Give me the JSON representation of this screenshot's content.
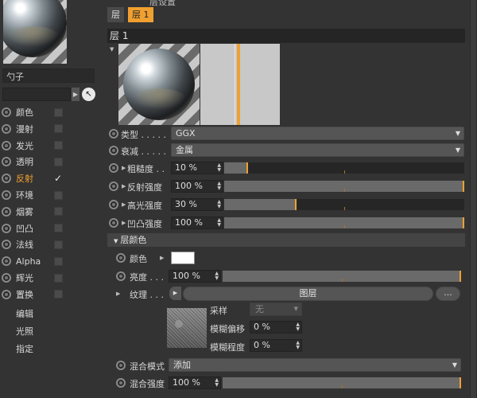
{
  "left_panel": {
    "material_name": "勺子",
    "channels": [
      {
        "label": "颜色",
        "checked": false
      },
      {
        "label": "漫射",
        "checked": false
      },
      {
        "label": "发光",
        "checked": false
      },
      {
        "label": "透明",
        "checked": false
      },
      {
        "label": "反射",
        "checked": true,
        "active": true
      },
      {
        "label": "环境",
        "checked": false
      },
      {
        "label": "烟雾",
        "checked": false
      },
      {
        "label": "凹凸",
        "checked": false
      },
      {
        "label": "法线",
        "checked": false
      },
      {
        "label": "Alpha",
        "checked": false
      },
      {
        "label": "辉光",
        "checked": false
      },
      {
        "label": "置换",
        "checked": false
      }
    ],
    "extra_items": [
      "编辑",
      "光照",
      "指定"
    ],
    "check_glyph": "✓"
  },
  "right_panel": {
    "top_title": "层设置",
    "tabs": [
      "层",
      "层 1"
    ],
    "layer_header": "层 1",
    "type": {
      "label": "类型 . . . . .",
      "value": "GGX"
    },
    "attenuation": {
      "label": "衰减 . . . . .",
      "value": "金属"
    },
    "roughness": {
      "label": "粗糙度 . .",
      "value": "10 %",
      "level": 0.1
    },
    "reflection_strength": {
      "label": "反射强度",
      "value": "100 %",
      "level": 1.0
    },
    "specular_strength": {
      "label": "高光强度",
      "value": "30 %",
      "level": 0.3
    },
    "bump_strength": {
      "label": "凹凸强度",
      "value": "100 %",
      "level": 1.0
    },
    "color_section": {
      "header": "层颜色",
      "color_label": "颜色",
      "color_value": "#ffffff",
      "brightness": {
        "label": "亮度 . . .",
        "value": "100 %",
        "level": 1.0
      },
      "texture_label": "纹理 . . .",
      "texture_button": "图层",
      "ellipsis": "...",
      "sampling_label": "采样",
      "sampling_value": "无",
      "blur_offset_label": "模糊偏移",
      "blur_offset_value": "0 %",
      "blur_degree_label": "模糊程度",
      "blur_degree_value": "0 %",
      "blend_mode": {
        "label": "混合模式",
        "value": "添加"
      },
      "blend_strength": {
        "label": "混合强度",
        "value": "100 %",
        "level": 1.0
      }
    }
  },
  "icons": {
    "collapse": "▼",
    "expand": "▶",
    "dropdown": "▼",
    "spinner": "▲▼",
    "picker": "↖"
  },
  "colors": {
    "accent": "#f0a030",
    "panel": "#333333",
    "field": "#2a2a2a"
  }
}
